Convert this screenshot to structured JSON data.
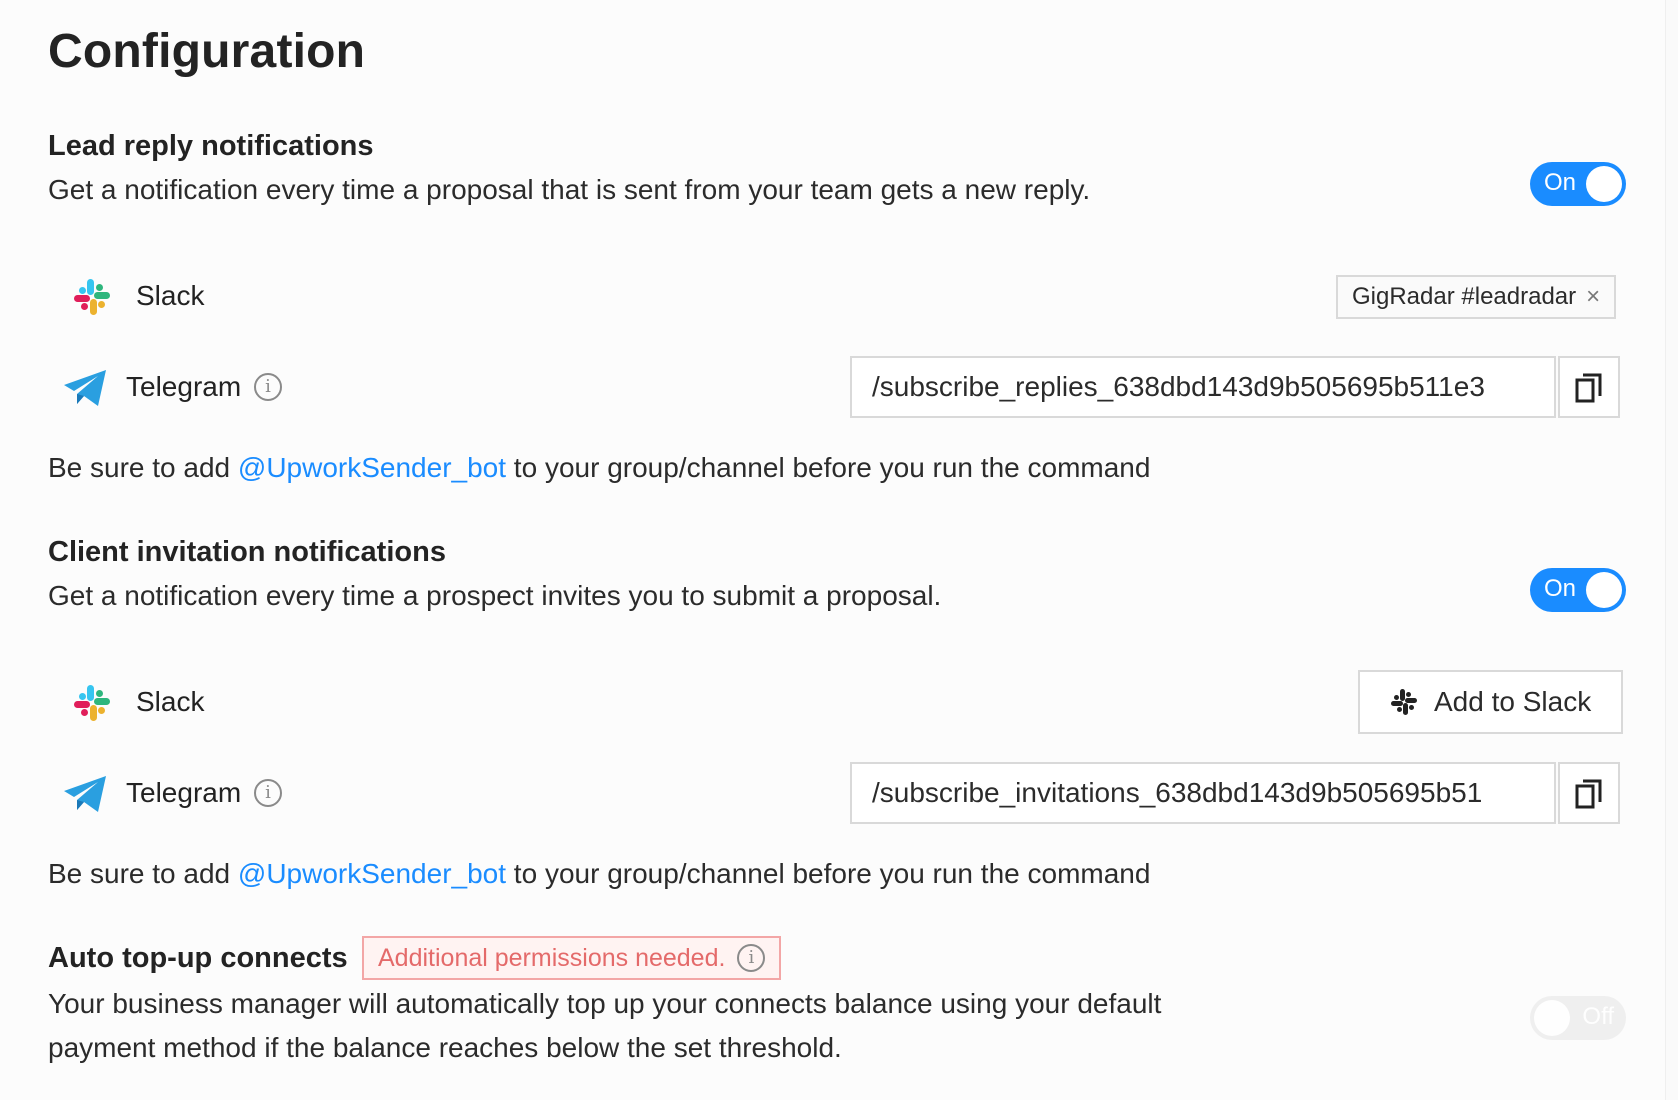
{
  "page": {
    "title": "Configuration"
  },
  "lead_reply": {
    "title": "Lead reply notifications",
    "description": "Get a notification every time a proposal that is sent from your team gets a new reply.",
    "toggle": {
      "state": "On",
      "on": true
    },
    "slack": {
      "label": "Slack",
      "tag": "GigRadar #leadradar",
      "tag_close": "×"
    },
    "telegram": {
      "label": "Telegram",
      "info": "i",
      "command": "/subscribe_replies_638dbd143d9b505695b511e3"
    },
    "help": {
      "prefix": "Be sure to add ",
      "bot": "@UpworkSender_bot",
      "suffix": " to your group/channel before you run the command"
    }
  },
  "client_invitation": {
    "title": "Client invitation notifications",
    "description": "Get a notification every time a prospect invites you to submit a proposal.",
    "toggle": {
      "state": "On",
      "on": true
    },
    "slack": {
      "label": "Slack",
      "button": "Add to Slack"
    },
    "telegram": {
      "label": "Telegram",
      "info": "i",
      "command": "/subscribe_invitations_638dbd143d9b505695b51"
    },
    "help": {
      "prefix": "Be sure to add ",
      "bot": "@UpworkSender_bot",
      "suffix": " to your group/channel before you run the command"
    }
  },
  "auto_topup": {
    "title": "Auto top-up connects",
    "badge": "Additional permissions needed.",
    "badge_info": "i",
    "description_line1": "Your business manager will automatically top up your connects balance using your default",
    "description_line2": "payment method if the balance reaches below the set threshold.",
    "toggle": {
      "state": "Off",
      "on": false
    }
  },
  "colors": {
    "accent": "#1a8cff",
    "warning_text": "#e46a6a",
    "warning_border": "#f3a6a6"
  },
  "icons": {
    "slack": "slack-icon",
    "telegram": "telegram-icon",
    "copy": "copy-icon",
    "info": "info-icon",
    "close": "close-icon"
  }
}
